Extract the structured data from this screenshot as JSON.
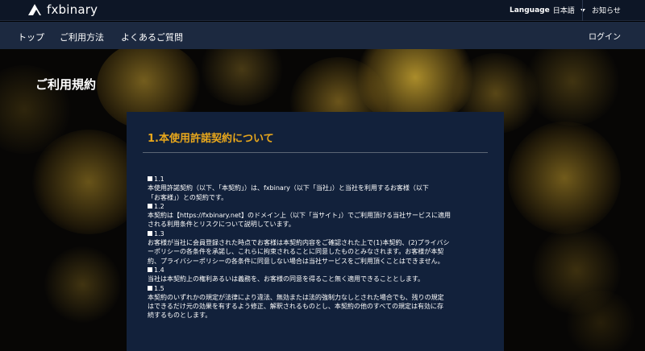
{
  "header": {
    "brand": "fxbinary",
    "language_label": "Language",
    "language_value": "日本語",
    "news_link": "お知らせ"
  },
  "nav": {
    "items": [
      "トップ",
      "ご利用方法",
      "よくあるご質問"
    ],
    "login": "ログイン"
  },
  "page": {
    "title": "ご利用規約"
  },
  "section": {
    "heading": "1.本使用許諾契約について",
    "clauses": [
      {
        "number": "1.1",
        "lines": [
          "本使用許諾契約（以下、「本契約」）は、fxbinary（以下「当社」）と当社を利用するお客様（以下",
          "「お客様」）との契約です。"
        ]
      },
      {
        "number": "1.2",
        "lines": [
          "本契約は【https://fxbinary.net】のドメイン上（以下「当サイト」）でご利用頂ける当社サービスに適用",
          "される利用条件とリスクについて説明しています。"
        ]
      },
      {
        "number": "1.3",
        "lines": [
          "お客様が当社に会員登録された時点でお客様は本契約内容をご確認された上で(1)本契約、(2)プライバシ",
          "ーポリシーの各条件を承諾し、これらに拘束されることに同意したものとみなされます。お客様が本契",
          "約、プライバシーポリシーの各条件に同意しない場合は当社サービスをご利用頂くことはできません。"
        ]
      },
      {
        "number": "1.4",
        "lines": [
          "当社は本契約上の権利あるいは義務を、お客様の同意を得ること無く適用できることとします。"
        ]
      },
      {
        "number": "1.5",
        "lines": [
          "本契約のいずれかの規定が法律により違法、無効または法的強制力なしとされた場合でも、残りの規定",
          "はできるだけ元の効果を有するよう修正、解釈されるものとし、本契約の他のすべての規定は有効に存",
          "続するものとします。"
        ]
      }
    ]
  },
  "colors": {
    "topbar": "#0d1626",
    "navbar": "#1c2940",
    "card": "#12213b",
    "heading_accent": "#e8a71c",
    "bokeh_gold": "#c9a22a"
  },
  "icons": {
    "logo": "triangle-logo-icon",
    "language_dropdown": "caret-down-icon"
  }
}
